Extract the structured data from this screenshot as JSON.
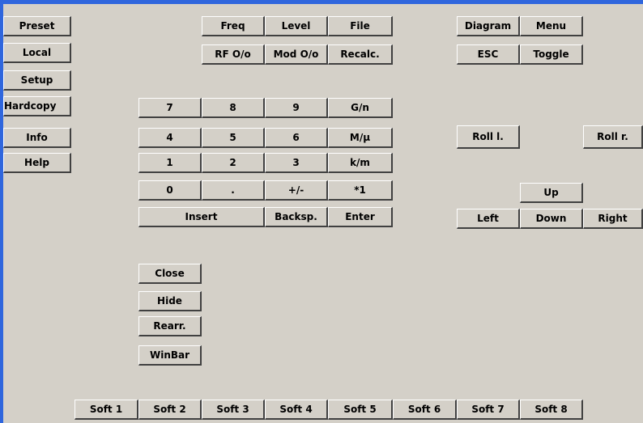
{
  "window": {
    "accent_color": "#2f66dd",
    "background_color": "#d4d0c8"
  },
  "left_column": {
    "preset": "Preset",
    "local": "Local",
    "setup": "Setup",
    "hardcopy": "Hardcopy",
    "info": "Info",
    "help": "Help"
  },
  "function_keys": {
    "freq": "Freq",
    "level": "Level",
    "file": "File",
    "rf_onoff": "RF O/o",
    "mod_onoff": "Mod O/o",
    "recalc": "Recalc."
  },
  "display_keys": {
    "diagram": "Diagram",
    "menu": "Menu",
    "esc": "ESC",
    "toggle": "Toggle"
  },
  "keypad": {
    "seven": "7",
    "eight": "8",
    "nine": "9",
    "g_n": "G/n",
    "four": "4",
    "five": "5",
    "six": "6",
    "m_u": "M/µ",
    "one": "1",
    "two": "2",
    "three": "3",
    "k_m": "k/m",
    "zero": "0",
    "dot": ".",
    "plus_minus": "+/-",
    "times_one": "*1",
    "insert": "Insert",
    "backspace": "Backsp.",
    "enter": "Enter"
  },
  "navigation": {
    "roll_left": "Roll l.",
    "roll_right": "Roll r.",
    "up": "Up",
    "left": "Left",
    "down": "Down",
    "right": "Right"
  },
  "window_keys": {
    "close": "Close",
    "hide": "Hide",
    "rearrange": "Rearr.",
    "winbar": "WinBar"
  },
  "softkeys": [
    "Soft 1",
    "Soft 2",
    "Soft 3",
    "Soft 4",
    "Soft 5",
    "Soft 6",
    "Soft 7",
    "Soft 8"
  ]
}
